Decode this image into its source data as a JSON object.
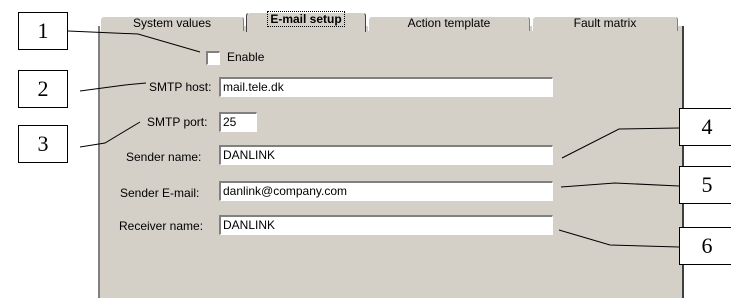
{
  "tabs": [
    {
      "label": "System values"
    },
    {
      "label": "E-mail setup"
    },
    {
      "label": "Action template"
    },
    {
      "label": "Fault matrix"
    }
  ],
  "enable": {
    "label": "Enable",
    "checked": false
  },
  "fields": {
    "smtp_host": {
      "label": "SMTP host:",
      "value": "mail.tele.dk"
    },
    "smtp_port": {
      "label": "SMTP port:",
      "value": "25"
    },
    "sender_name": {
      "label": "Sender name:",
      "value": "DANLINK"
    },
    "sender_email": {
      "label": "Sender E-mail:",
      "value": "danlink@company.com"
    },
    "receiver_name": {
      "label": "Receiver name:",
      "value": "DANLINK"
    }
  },
  "callouts": [
    "1",
    "2",
    "3",
    "4",
    "5",
    "6"
  ]
}
